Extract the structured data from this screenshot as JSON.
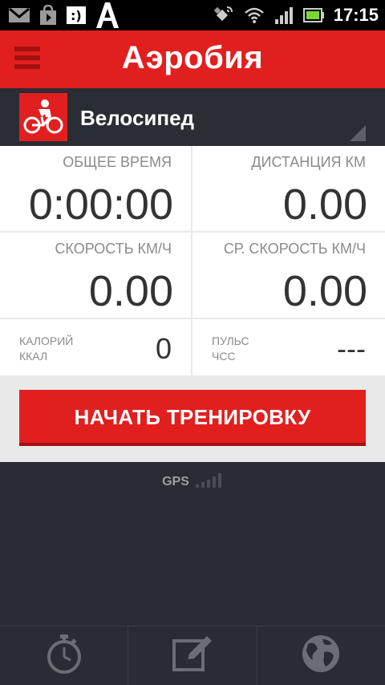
{
  "status_bar": {
    "time": "17:15",
    "icons": [
      "gmail-icon",
      "store-icon",
      "screenshot-icon",
      "font-a-icon",
      "gps-icon",
      "wifi-icon",
      "signal-icon",
      "battery-icon"
    ],
    "battery_color": "#7bd62f"
  },
  "app_bar": {
    "title": "Аэробия",
    "menu_icon": "hamburger-menu-icon",
    "color": "#e21f1f"
  },
  "activity": {
    "label": "Велосипед",
    "icon": "bicycle-icon"
  },
  "stats": {
    "total_time": {
      "label": "ОБЩЕЕ ВРЕМЯ",
      "value": "0:00:00"
    },
    "distance": {
      "label": "ДИСТАНЦИЯ КМ",
      "value": "0.00"
    },
    "speed": {
      "label": "СКОРОСТЬ КМ/Ч",
      "value": "0.00"
    },
    "avg_speed": {
      "label": "СР. СКОРОСТЬ КМ/Ч",
      "value": "0.00"
    },
    "calories": {
      "label_line1": "КАЛОРИЙ",
      "label_line2": "ККАЛ",
      "value": "0"
    },
    "pulse": {
      "label_line1": "ПУЛЬС",
      "label_line2": "ЧСС",
      "value": "---"
    }
  },
  "start_button": {
    "label": "НАЧАТЬ ТРЕНИРОВКУ"
  },
  "gps": {
    "label": "GPS",
    "icon": "gps-signal-icon"
  },
  "bottom_nav": {
    "items": [
      "stopwatch-icon",
      "edit-note-icon",
      "globe-icon"
    ]
  }
}
